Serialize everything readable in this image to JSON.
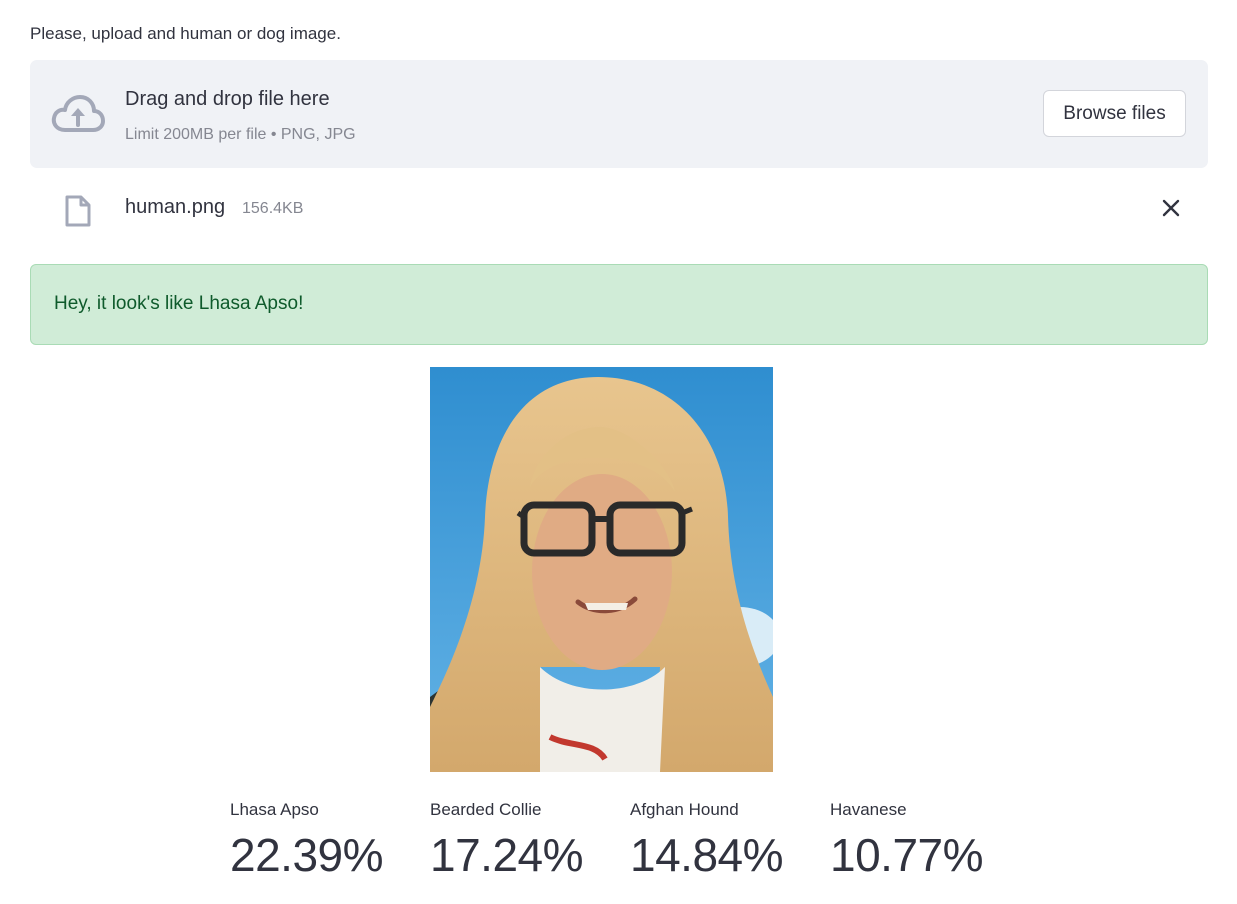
{
  "prompt_label": "Please, upload and human or dog image.",
  "uploader": {
    "title": "Drag and drop file here",
    "subtitle": "Limit 200MB per file • PNG, JPG",
    "browse_label": "Browse files",
    "icon": "cloud-upload-icon"
  },
  "file": {
    "name": "human.png",
    "size": "156.4KB",
    "icon": "file-icon"
  },
  "result": {
    "message": "Hey, it look's like Lhasa Apso!"
  },
  "metrics": [
    {
      "label": "Lhasa Apso",
      "value": "22.39%"
    },
    {
      "label": "Bearded Collie",
      "value": "17.24%"
    },
    {
      "label": "Afghan Hound",
      "value": "14.84%"
    },
    {
      "label": "Havanese",
      "value": "10.77%"
    }
  ],
  "colors": {
    "success_bg": "#d0ecd7",
    "success_text": "#0e5a2b",
    "dropzone_bg": "#f0f2f6",
    "icon_gray": "#a3a8b8"
  }
}
